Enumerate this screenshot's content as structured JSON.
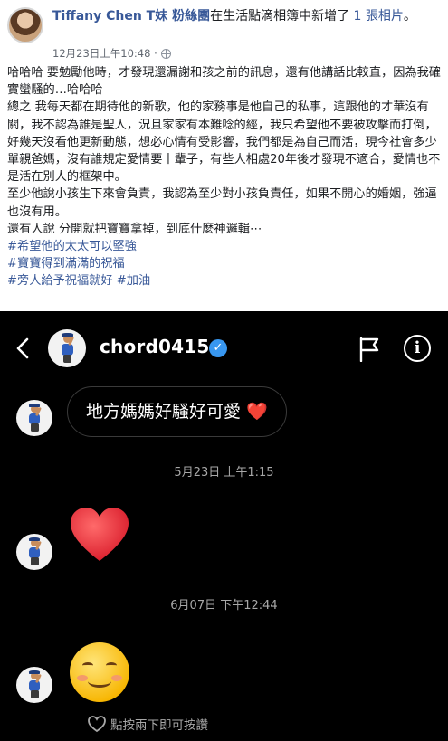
{
  "fb_post": {
    "author": "Tiffany Chen T妹 粉絲團",
    "action": "在生活點滴相簿中新增了",
    "count_text": " 1 張相片",
    "action_end": "。",
    "timestamp": "12月23日上午10:48 · ",
    "body": [
      "哈哈哈 要勉勵他時，才發現還漏謝和孩之前的訊息，還有他講話比較直，因為我確實蠻騷的…哈哈哈",
      "總之 我每天都在期待他的新歌，他的家務事是他自己的私事，這跟他的才華沒有關，我不認為誰是聖人，況且家家有本難唸的經，我只希望他不要被攻擊而打倒，好幾天沒看他更新動態，想必心情有受影響，我們都是為自己而活，現今社會多少單親爸媽，沒有誰規定愛情要丨輩子，有些人相處20年後才發現不適合，愛情也不是活在別人的框架中。",
      "至少他說小孩生下來會負責，我認為至少對小孩負責任，如果不開心的婚姻，強逼也沒有用。",
      "還有人說 分開就把寶寶拿掉，到底什麼神邏輯⋯"
    ],
    "hashtags": [
      "#希望他的太太可以堅強",
      "#寶寶得到滿滿的祝福",
      "#旁人給予祝福就好 #加油"
    ]
  },
  "ig": {
    "username": "chord0415",
    "verified_mark": "✓",
    "info_label": "i",
    "message_text": "地方媽媽好騷好可愛 ",
    "message_heart": "❤️",
    "timestamps": [
      "5月23日 上午1:15",
      "6月07日 下午12:44"
    ],
    "like_hint": "點按兩下即可按讚",
    "icons": [
      "back-arrow-icon",
      "verified-badge-icon",
      "flag-icon",
      "info-icon",
      "heart-icon",
      "smiling-face-icon",
      "heart-outline-icon"
    ],
    "colors": {
      "background": "#000000",
      "verified": "#3897f0",
      "heart": "#ed2b3b"
    }
  }
}
